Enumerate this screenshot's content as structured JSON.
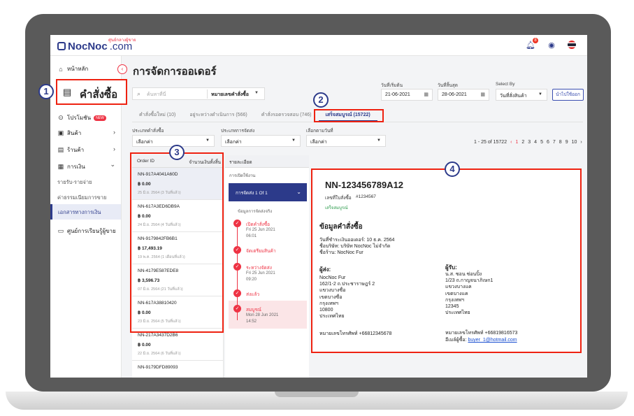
{
  "app": {
    "logo_text": "NocNoc",
    "logo_domain": ".com",
    "logo_sub": "ศูนย์กลางผู้ขาย"
  },
  "topbar": {
    "notif_count": "8"
  },
  "sidebar": {
    "items": [
      {
        "label": "หน้าหลัก",
        "icon": "home-icon"
      },
      {
        "label": "โปรโมชัน",
        "icon": "promo-icon",
        "badge": "NEW"
      },
      {
        "label": "สินค้า",
        "icon": "box-icon"
      },
      {
        "label": "ร้านค้า",
        "icon": "shop-icon"
      },
      {
        "label": "การเงิน",
        "icon": "money-icon"
      },
      {
        "label": "ศูนย์การเรียนรู้ผู้ขาย",
        "icon": "book-icon"
      }
    ],
    "sub_items": [
      "รายรับ-รายจ่าย",
      "ค่าธรรมเนียมการขาย",
      "เอกสารทางการเงิน"
    ],
    "highlight_label": "คำสั่งซื้อ"
  },
  "page": {
    "title": "การจัดการออเดอร์"
  },
  "search": {
    "placeholder": "ค้นหาที่นี่",
    "type_label": "หมายเลขคำสั่งซื้อ"
  },
  "filters": {
    "start_label": "วันที่เริ่มต้น",
    "start_value": "21-06-2021",
    "end_label": "วันที่สิ้นสุด",
    "end_value": "28-06-2021",
    "select_by_label": "Select By",
    "select_by_value": "วันที่สั่งสินค้า",
    "apply_label": "นำไปใช้ออก",
    "order_type_label": "ประเภทคำสั่งซื้อ",
    "order_type_value": "เลือกค่า",
    "ship_type_label": "ประเภทการจัดส่ง",
    "ship_type_value": "เลือกค่า",
    "date_select_label": "เลือกตามวันที่",
    "date_select_value": "เลือกค่า"
  },
  "tabs": [
    {
      "label": "คำสั่งซื้อใหม่ (10)"
    },
    {
      "label": "อยู่ระหว่างดำเนินการ (566)"
    },
    {
      "label": "คำสั่งรอตรวจสอบ (746)"
    },
    {
      "label": "เสร็จสมบูรณ์ (15722)"
    }
  ],
  "pager": {
    "range": "1 - 25 of 15722",
    "pages": [
      "1",
      "2",
      "3",
      "4",
      "5",
      "6",
      "7",
      "8",
      "9",
      "10"
    ],
    "current": "1"
  },
  "list": {
    "col_id": "Order ID",
    "col_amount": "จำนวนเงินทั้งสิ้น",
    "orders": [
      {
        "id": "NN-917A4041A60D",
        "amount": "฿ 0.00",
        "date": "25 มิ.ย. 2564   (3 วันที่แล้ว)"
      },
      {
        "id": "NN-617A3ED6DB9A",
        "amount": "฿ 0.00",
        "date": "24 มิ.ย. 2564   (4 วันที่แล้ว)"
      },
      {
        "id": "NN-9179842FB6B1",
        "amount": "฿ 17,493.19",
        "date": "19 พ.ค. 2564   (1 เดือนที่แล้ว)"
      },
      {
        "id": "NN-4179E587EDE8",
        "amount": "฿ 3,596.73",
        "date": "07 มิ.ย. 2564   (21 วันที่แล้ว)"
      },
      {
        "id": "NN-617A38810420",
        "amount": "฿ 0.00",
        "date": "23 มิ.ย. 2564   (5 วันที่แล้ว)"
      },
      {
        "id": "NN-217A3437D2B6",
        "amount": "฿ 0.00",
        "date": "22 มิ.ย. 2564   (6 วันที่แล้ว)"
      },
      {
        "id": "NN-9179DFD89093",
        "amount": "",
        "date": ""
      }
    ]
  },
  "status": {
    "header": "รายละเอียด",
    "sub": "การเปิดใช้งาน",
    "dropdown": "การจัดส่ง 1 Of 1",
    "caption": "ข้อมูลการจัดส่งจริง",
    "steps": [
      {
        "title": "เปิดคำสั่งซื้อ",
        "sub1": "Fri 25 Jun 2021",
        "sub2": "06:01"
      },
      {
        "title": "จัดเตรียมสินค้า",
        "sub1": "",
        "sub2": ""
      },
      {
        "title": "ระหว่างจัดส่ง",
        "sub1": "Fri 25 Jun 2021",
        "sub2": "09:20"
      },
      {
        "title": "ส่งแล้ว",
        "sub1": "",
        "sub2": ""
      },
      {
        "title": "สมบูรณ์",
        "sub1": "Mon 28 Jun 2021",
        "sub2": "14:52"
      }
    ]
  },
  "detail": {
    "order_number": "NN-123456789A12",
    "ref_label": "เลขที่ใบสั่งซื้อ",
    "ref_value": "#1234567",
    "status": "เสร็จสมบูรณ์",
    "section_title": "ข้อมูลคำสั่งซื้อ",
    "payment_date": "วันที่ชำระเงินออเดอร์: 10 ธ.ค. 2564",
    "company": "ชื่อบริษัท: บริษัท NocNoc ไม่จำกัด",
    "shop": "ชื่อร้าน: NocNoc Fur",
    "sender_title": "ผู้ส่ง:",
    "sender_lines": [
      "NocNoc Fur",
      "162/1-2 ถ.ประชาราษฎร์ 2",
      "แขวงบางซื่อ",
      "เขตบางซื่อ",
      "  กรุงเทพฯ",
      "10800",
      "ประเทศไทย"
    ],
    "sender_phone": "หมายเลขโทรศัพท์ +66812345678",
    "receiver_title": "ผู้รับ:",
    "receiver_lines": [
      "น.ส. ซอน  ซ่อนปิ้ง",
      "1/23 ถ.กาญจนาภิเษก1",
      "แขวงบางแค",
      "เขตบางแค",
      "  กรุงเทพฯ",
      "12345",
      "ประเทศไทย"
    ],
    "receiver_phone": "หมายเลขโทรศัพท์ +66819816573",
    "receiver_email_label": "อีเมล์ผู้ซื้อ:",
    "receiver_email": "buyer_1@hotmail.com"
  },
  "callouts": [
    "1",
    "2",
    "3",
    "4"
  ],
  "colors": {
    "brand": "#2c3a8a",
    "accent": "#e34",
    "callout": "#e21",
    "success": "#2a9a4a"
  }
}
